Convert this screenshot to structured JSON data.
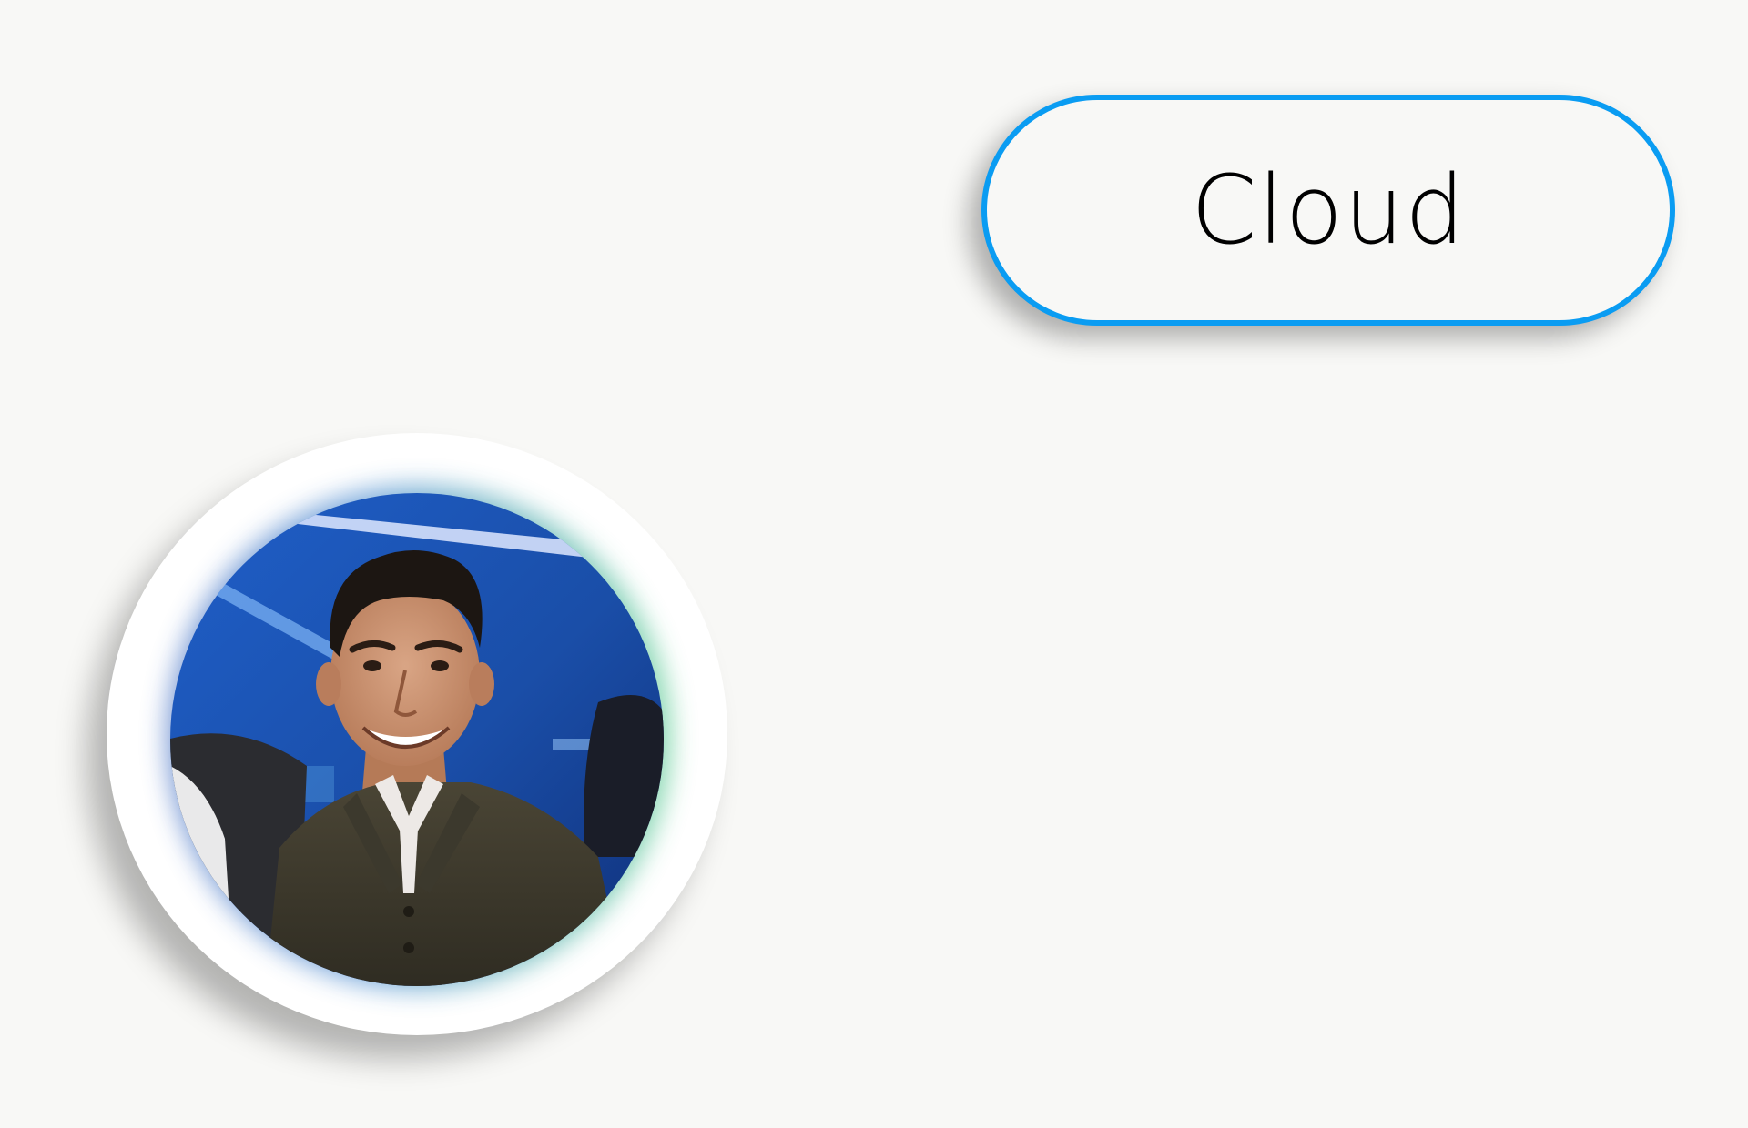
{
  "button": {
    "label": "Cloud",
    "border_color": "#0a9cf2"
  },
  "avatar": {
    "icon": "user-photo",
    "ring_color": "#ffffff",
    "glow_colors": [
      "#6a93d6",
      "#7ed7a8"
    ]
  },
  "colors": {
    "background": "#f8f8f6"
  }
}
